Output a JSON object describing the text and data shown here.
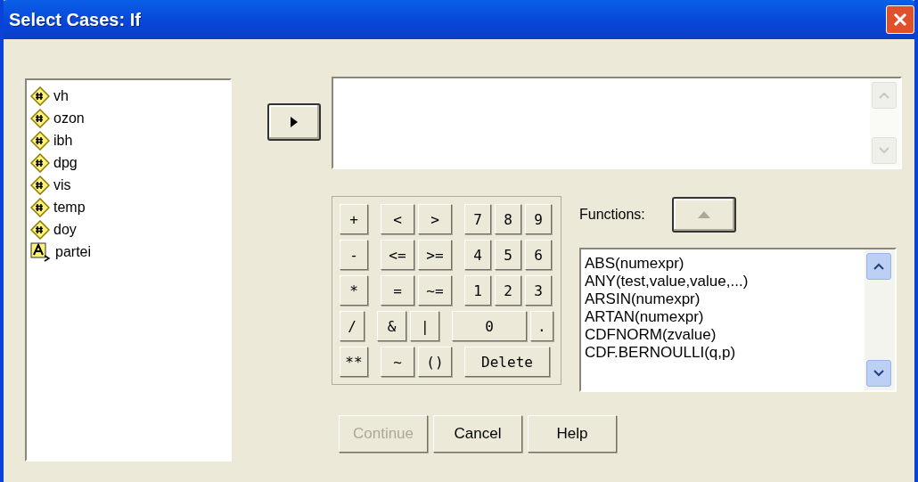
{
  "window": {
    "title": "Select Cases: If"
  },
  "variables": [
    {
      "name": "vh",
      "kind": "numeric"
    },
    {
      "name": "ozon",
      "kind": "numeric"
    },
    {
      "name": "ibh",
      "kind": "numeric"
    },
    {
      "name": "dpg",
      "kind": "numeric"
    },
    {
      "name": "vis",
      "kind": "numeric"
    },
    {
      "name": "temp",
      "kind": "numeric"
    },
    {
      "name": "doy",
      "kind": "numeric"
    },
    {
      "name": "partei",
      "kind": "string"
    }
  ],
  "keypad": [
    [
      {
        "label": "+",
        "kind": "op"
      },
      {
        "label": "<",
        "kind": "key"
      },
      {
        "label": ">",
        "kind": "key"
      },
      {
        "label": "7",
        "kind": "digit"
      },
      {
        "label": "8",
        "kind": "digit"
      },
      {
        "label": "9",
        "kind": "digit"
      }
    ],
    [
      {
        "label": "-",
        "kind": "op"
      },
      {
        "label": "<=",
        "kind": "key"
      },
      {
        "label": ">=",
        "kind": "key"
      },
      {
        "label": "4",
        "kind": "digit"
      },
      {
        "label": "5",
        "kind": "digit"
      },
      {
        "label": "6",
        "kind": "digit"
      }
    ],
    [
      {
        "label": "*",
        "kind": "op"
      },
      {
        "label": "=",
        "kind": "key"
      },
      {
        "label": "~=",
        "kind": "key"
      },
      {
        "label": "1",
        "kind": "digit"
      },
      {
        "label": "2",
        "kind": "digit"
      },
      {
        "label": "3",
        "kind": "digit"
      }
    ],
    [
      {
        "label": "/",
        "kind": "op"
      },
      {
        "label": "&",
        "kind": "key"
      },
      {
        "label": "|",
        "kind": "key"
      },
      {
        "label": "0",
        "kind": "wide"
      },
      {
        "label": ".",
        "kind": "digit"
      }
    ],
    [
      {
        "label": "**",
        "kind": "op"
      },
      {
        "label": "~",
        "kind": "key"
      },
      {
        "label": "()",
        "kind": "key"
      },
      {
        "label": "Delete",
        "kind": "wide"
      }
    ]
  ],
  "functions": {
    "label": "Functions:",
    "items": [
      "ABS(numexpr)",
      "ANY(test,value,value,...)",
      "ARSIN(numexpr)",
      "ARTAN(numexpr)",
      "CDFNORM(zvalue)",
      "CDF.BERNOULLI(q,p)"
    ]
  },
  "buttons": [
    {
      "label": "Continue",
      "disabled": true
    },
    {
      "label": "Cancel",
      "disabled": false
    },
    {
      "label": "Help",
      "disabled": false
    }
  ]
}
